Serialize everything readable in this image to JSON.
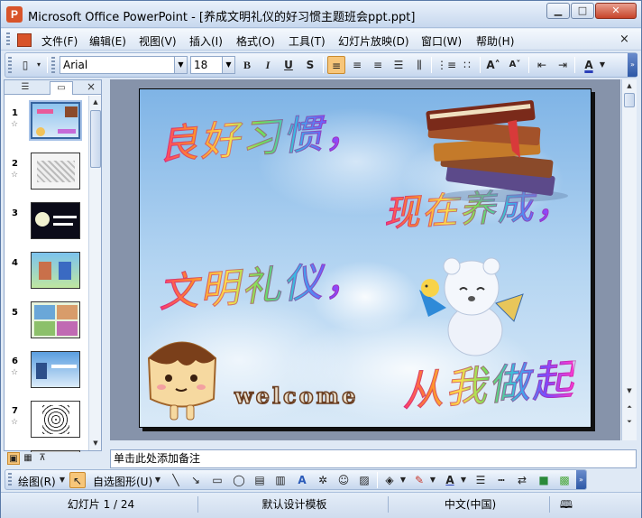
{
  "window": {
    "title": "Microsoft Office PowerPoint - [养成文明礼仪的好习惯主题班会ppt.ppt]",
    "app_icon_label": "P",
    "controls": [
      "minimize-icon",
      "maximize-icon",
      "close-icon"
    ]
  },
  "menu": {
    "items": [
      "文件(F)",
      "编辑(E)",
      "视图(V)",
      "插入(I)",
      "格式(O)",
      "工具(T)",
      "幻灯片放映(D)",
      "窗口(W)",
      "帮助(H)"
    ],
    "close_glyph": "×"
  },
  "toolbar": {
    "font_name": "Arial",
    "font_size": "18",
    "bold": "B",
    "italic": "I",
    "underline": "U",
    "shadow": "S",
    "font_color_label": "A"
  },
  "slides_pane": {
    "close_glyph": "×",
    "slides": [
      {
        "num": "1",
        "animated": true,
        "selected": true
      },
      {
        "num": "2",
        "animated": true,
        "selected": false
      },
      {
        "num": "3",
        "animated": false,
        "selected": false
      },
      {
        "num": "4",
        "animated": false,
        "selected": false
      },
      {
        "num": "5",
        "animated": false,
        "selected": false
      },
      {
        "num": "6",
        "animated": true,
        "selected": false
      },
      {
        "num": "7",
        "animated": true,
        "selected": false
      }
    ],
    "star_glyph": "☆"
  },
  "slide": {
    "text1": "良好习惯，",
    "text2": "现在养成，",
    "text3": "文明礼仪，",
    "text4": "从我做起",
    "welcome": "welcome"
  },
  "notes": {
    "placeholder": "单击此处添加备注"
  },
  "drawing_toolbar": {
    "draw_label": "绘图(R)",
    "autoshapes_label": "自选图形(U)"
  },
  "status": {
    "slide_info": "幻灯片 1 / 24",
    "template": "默认设计模板",
    "language": "中文(中国)"
  }
}
